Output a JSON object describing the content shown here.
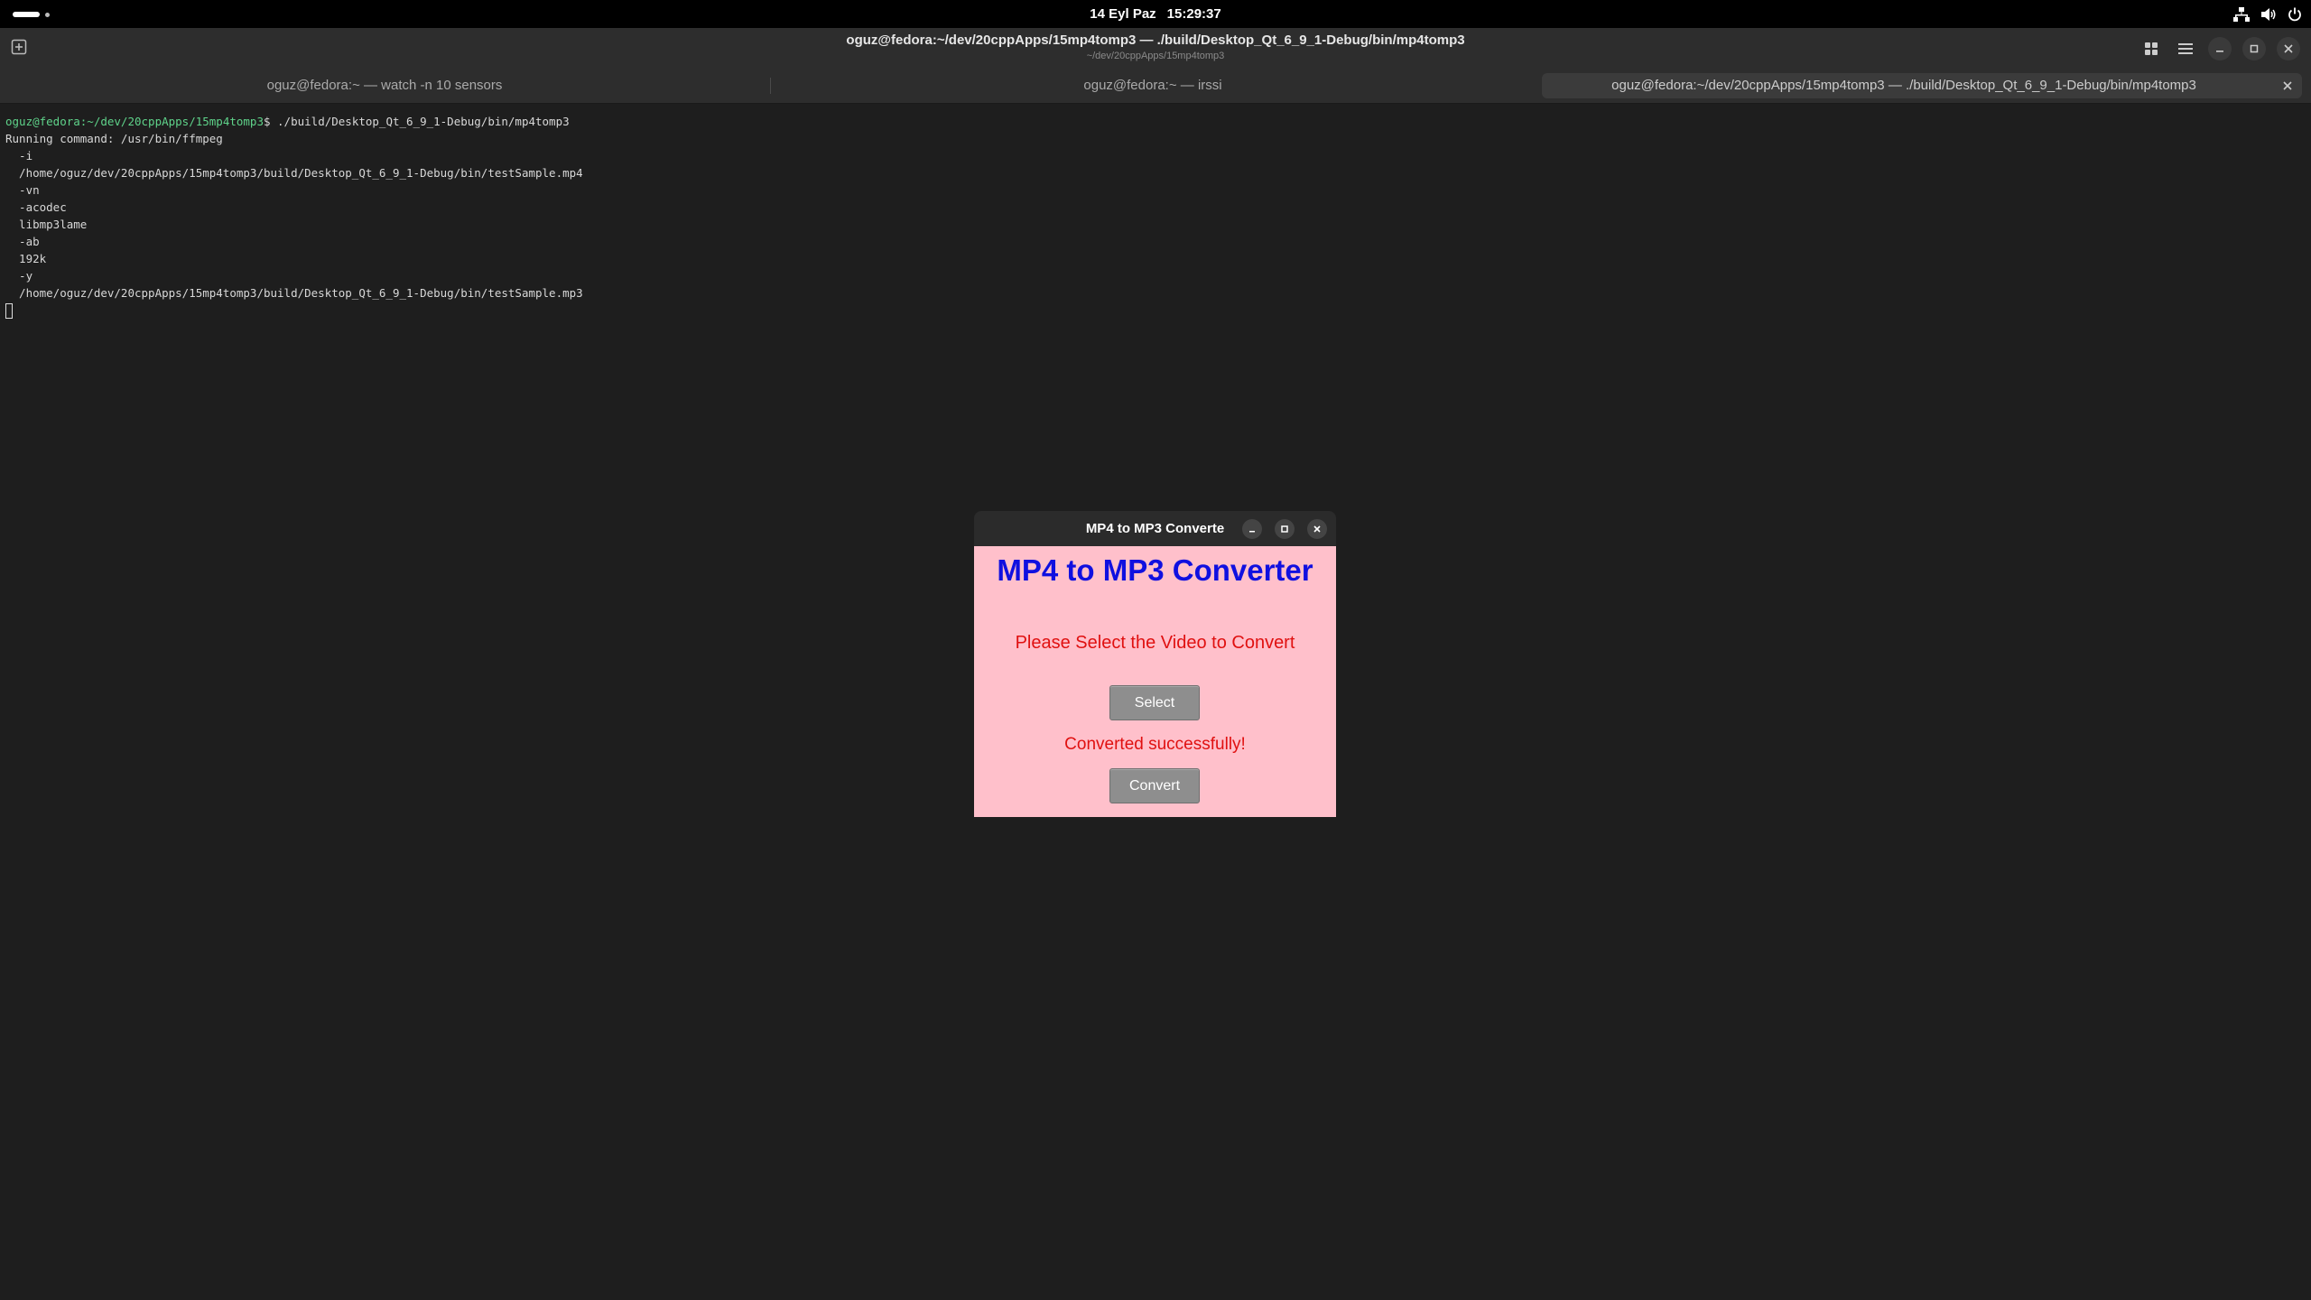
{
  "topbar": {
    "date": "14 Eyl Paz",
    "time": "15:29:37"
  },
  "window": {
    "title": "oguz@fedora:~/dev/20cppApps/15mp4tomp3 — ./build/Desktop_Qt_6_9_1-Debug/bin/mp4tomp3",
    "subtitle": "~/dev/20cppApps/15mp4tomp3"
  },
  "tabs": [
    {
      "label": "oguz@fedora:~ — watch -n 10 sensors"
    },
    {
      "label": "oguz@fedora:~ — irssi"
    },
    {
      "label": "oguz@fedora:~/dev/20cppApps/15mp4tomp3 — ./build/Desktop_Qt_6_9_1-Debug/bin/mp4tomp3"
    }
  ],
  "terminal": {
    "prompt": "oguz@fedora:~/dev/20cppApps/15mp4tomp3",
    "command": "$ ./build/Desktop_Qt_6_9_1-Debug/bin/mp4tomp3",
    "lines": [
      "Running command: /usr/bin/ffmpeg",
      "  -i",
      "  /home/oguz/dev/20cppApps/15mp4tomp3/build/Desktop_Qt_6_9_1-Debug/bin/testSample.mp4",
      "  -vn",
      "  -acodec",
      "  libmp3lame",
      "  -ab",
      "  192k",
      "  -y",
      "  /home/oguz/dev/20cppApps/15mp4tomp3/build/Desktop_Qt_6_9_1-Debug/bin/testSample.mp3"
    ]
  },
  "app": {
    "window_title": "MP4 to MP3 Converte",
    "heading": "MP4 to MP3 Converter",
    "instruction": "Please Select the Video to Convert",
    "select_label": "Select",
    "status": "Converted successfully!",
    "convert_label": "Convert",
    "colors": {
      "background": "#ffc0cb",
      "heading": "#1010e0",
      "text": "#e01010"
    }
  }
}
